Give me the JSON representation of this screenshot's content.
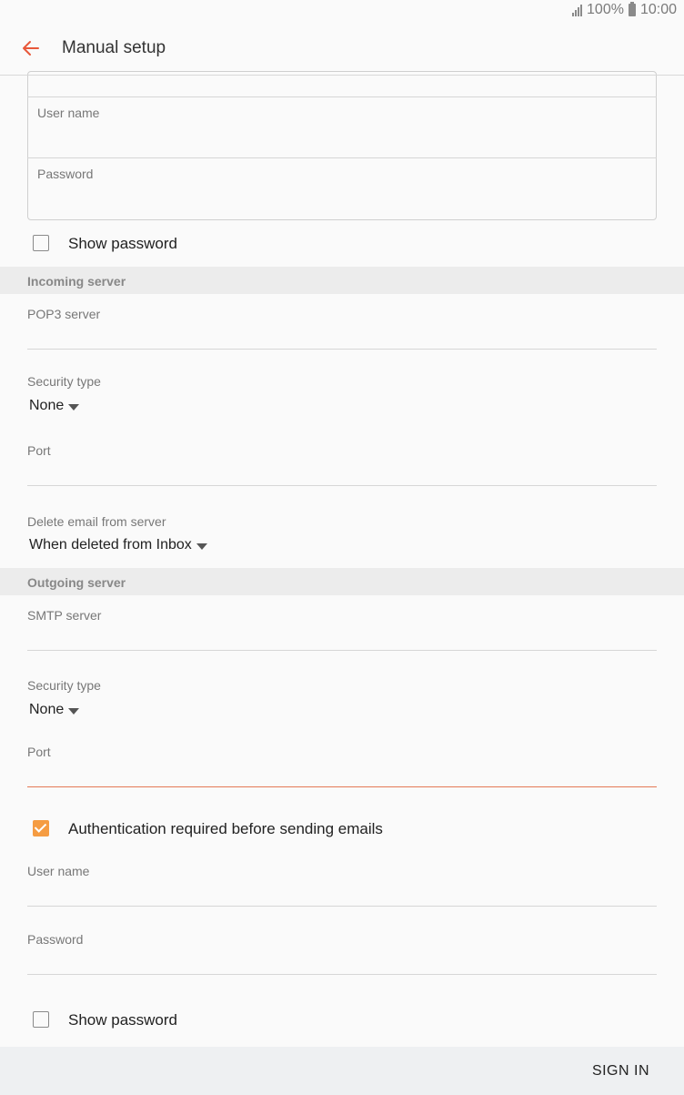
{
  "status_bar": {
    "battery": "100%",
    "time": "10:00"
  },
  "app_bar": {
    "title": "Manual setup"
  },
  "account": {
    "username_label": "User name",
    "password_label": "Password",
    "show_password_label": "Show password",
    "show_password_checked": false
  },
  "incoming": {
    "header": "Incoming server",
    "server_label": "POP3 server",
    "security_label": "Security type",
    "security_value": "None",
    "port_label": "Port",
    "delete_label": "Delete email from server",
    "delete_value": "When deleted from Inbox"
  },
  "outgoing": {
    "header": "Outgoing server",
    "server_label": "SMTP server",
    "security_label": "Security type",
    "security_value": "None",
    "port_label": "Port",
    "auth_label": "Authentication required before sending emails",
    "auth_checked": true,
    "username_label": "User name",
    "password_label": "Password",
    "show_password_label": "Show password",
    "show_password_checked": false
  },
  "footer": {
    "sign_in_label": "SIGN IN"
  },
  "colors": {
    "accent": "#e8583a",
    "checkbox_on": "#f59c42"
  }
}
